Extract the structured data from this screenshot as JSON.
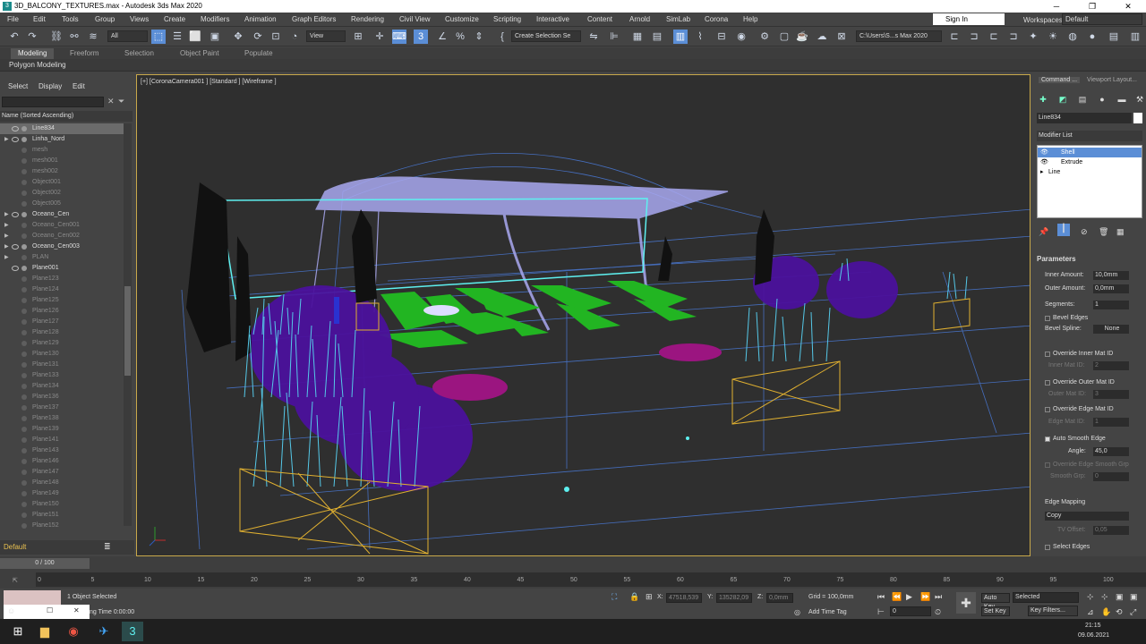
{
  "title": {
    "app": "3D_BALCONY_TEXTURES.max - Autodesk 3ds Max 2020"
  },
  "menu": [
    "File",
    "Edit",
    "Tools",
    "Group",
    "Views",
    "Create",
    "Modifiers",
    "Animation",
    "Graph Editors",
    "Rendering",
    "Civil View",
    "Customize",
    "Scripting",
    "Interactive",
    "Content",
    "Arnold",
    "SimLab",
    "Corona",
    "Help"
  ],
  "account": {
    "signin": "Sign In",
    "workspaces_label": "Workspaces:",
    "workspace": "Default"
  },
  "toolbar": {
    "filter": "All",
    "refcoord": "View",
    "selset": "Create Selection Se",
    "path": "C:\\Users\\S...s Max 2020"
  },
  "ribbon": {
    "tabs": [
      "Modeling",
      "Freeform",
      "Selection",
      "Object Paint",
      "Populate"
    ],
    "active": "Modeling",
    "sub": "Polygon Modeling"
  },
  "scene": {
    "menu": [
      "Select",
      "Display",
      "Edit"
    ],
    "sort_header": "Name (Sorted Ascending)",
    "rows": [
      {
        "name": "Line834",
        "sel": true,
        "expand": false,
        "vis": true
      },
      {
        "name": "Linha_Nord",
        "expand": true,
        "vis": true
      },
      {
        "name": "mesh",
        "dim": true
      },
      {
        "name": "mesh001",
        "dim": true
      },
      {
        "name": "mesh002",
        "dim": true
      },
      {
        "name": "Object001",
        "dim": true
      },
      {
        "name": "Object002",
        "dim": true
      },
      {
        "name": "Object005",
        "dim": true
      },
      {
        "name": "Oceano_Cen",
        "expand": true,
        "vis": true
      },
      {
        "name": "Oceano_Cen001",
        "dim": true,
        "expand": true
      },
      {
        "name": "Oceano_Cen002",
        "dim": true,
        "expand": true
      },
      {
        "name": "Oceano_Cen003",
        "expand": true,
        "vis": true
      },
      {
        "name": "PLAN",
        "dim": true,
        "expand": true
      },
      {
        "name": "Plane001",
        "vis": true
      },
      {
        "name": "Plane123",
        "dim": true
      },
      {
        "name": "Plane124",
        "dim": true
      },
      {
        "name": "Plane125",
        "dim": true
      },
      {
        "name": "Plane126",
        "dim": true
      },
      {
        "name": "Plane127",
        "dim": true
      },
      {
        "name": "Plane128",
        "dim": true
      },
      {
        "name": "Plane129",
        "dim": true
      },
      {
        "name": "Plane130",
        "dim": true
      },
      {
        "name": "Plane131",
        "dim": true
      },
      {
        "name": "Plane133",
        "dim": true
      },
      {
        "name": "Plane134",
        "dim": true
      },
      {
        "name": "Plane136",
        "dim": true
      },
      {
        "name": "Plane137",
        "dim": true
      },
      {
        "name": "Plane138",
        "dim": true
      },
      {
        "name": "Plane139",
        "dim": true
      },
      {
        "name": "Plane141",
        "dim": true
      },
      {
        "name": "Plane143",
        "dim": true
      },
      {
        "name": "Plane146",
        "dim": true
      },
      {
        "name": "Plane147",
        "dim": true
      },
      {
        "name": "Plane148",
        "dim": true
      },
      {
        "name": "Plane149",
        "dim": true
      },
      {
        "name": "Plane150",
        "dim": true
      },
      {
        "name": "Plane151",
        "dim": true
      },
      {
        "name": "Plane152",
        "dim": true
      }
    ],
    "layer": "Default"
  },
  "viewport": {
    "label": "[+] [CoronaCamera001 ] [Standard ] [Wireframe ]"
  },
  "command": {
    "tabs": [
      "Command ...",
      "Viewport Layout..."
    ],
    "object_name": "Line834",
    "modifier_list": "Modifier List",
    "stack": [
      "Shell",
      "Extrude",
      "Line"
    ],
    "params_title": "Parameters",
    "inner_label": "Inner Amount:",
    "inner": "10,0mm",
    "outer_label": "Outer Amount:",
    "outer": "0,0mm",
    "segments_label": "Segments:",
    "segments": "1",
    "bevel_edges": "Bevel Edges",
    "bevel_spline_label": "Bevel Spline:",
    "bevel_spline": "None",
    "override_inner": "Override Inner Mat ID",
    "inner_mat_label": "Inner Mat ID:",
    "inner_mat": "2",
    "override_outer": "Override Outer Mat ID",
    "outer_mat_label": "Outer Mat ID:",
    "outer_mat": "3",
    "override_edge": "Override Edge Mat ID",
    "edge_mat_label": "Edge Mat ID:",
    "edge_mat": "1",
    "auto_smooth": "Auto Smooth Edge",
    "angle_label": "Angle:",
    "angle": "45,0",
    "override_smooth": "Override Edge Smooth Grp",
    "smooth_grp_label": "Smooth Grp:",
    "smooth_grp": "0",
    "edge_mapping_title": "Edge Mapping",
    "edge_mapping": "Copy",
    "tv_offset_label": "TV Offset:",
    "tv_offset": "0,05",
    "select_edges": "Select Edges"
  },
  "timeline": {
    "frame": "0 / 100",
    "ticks": [
      "0",
      "5",
      "10",
      "15",
      "20",
      "25",
      "30",
      "35",
      "40",
      "45",
      "50",
      "55",
      "60",
      "65",
      "70",
      "75",
      "80",
      "85",
      "90",
      "95",
      "100"
    ]
  },
  "status": {
    "selected": "1 Object Selected",
    "time": "ng Time  0:00:00",
    "x_label": "X:",
    "x": "47518,539",
    "y_label": "Y:",
    "y": "135282,09",
    "z_label": "Z:",
    "z": "0,0mm",
    "grid": "Grid = 100,0mm",
    "add_time_tag": "Add Time Tag",
    "frame_spin": "0",
    "auto_key": "Auto Key",
    "key_mode": "Selected",
    "set_key": "Set Key",
    "key_filters": "Key Filters..."
  },
  "taskbar": {
    "clock": "21:15",
    "date": "09.06.2021"
  }
}
